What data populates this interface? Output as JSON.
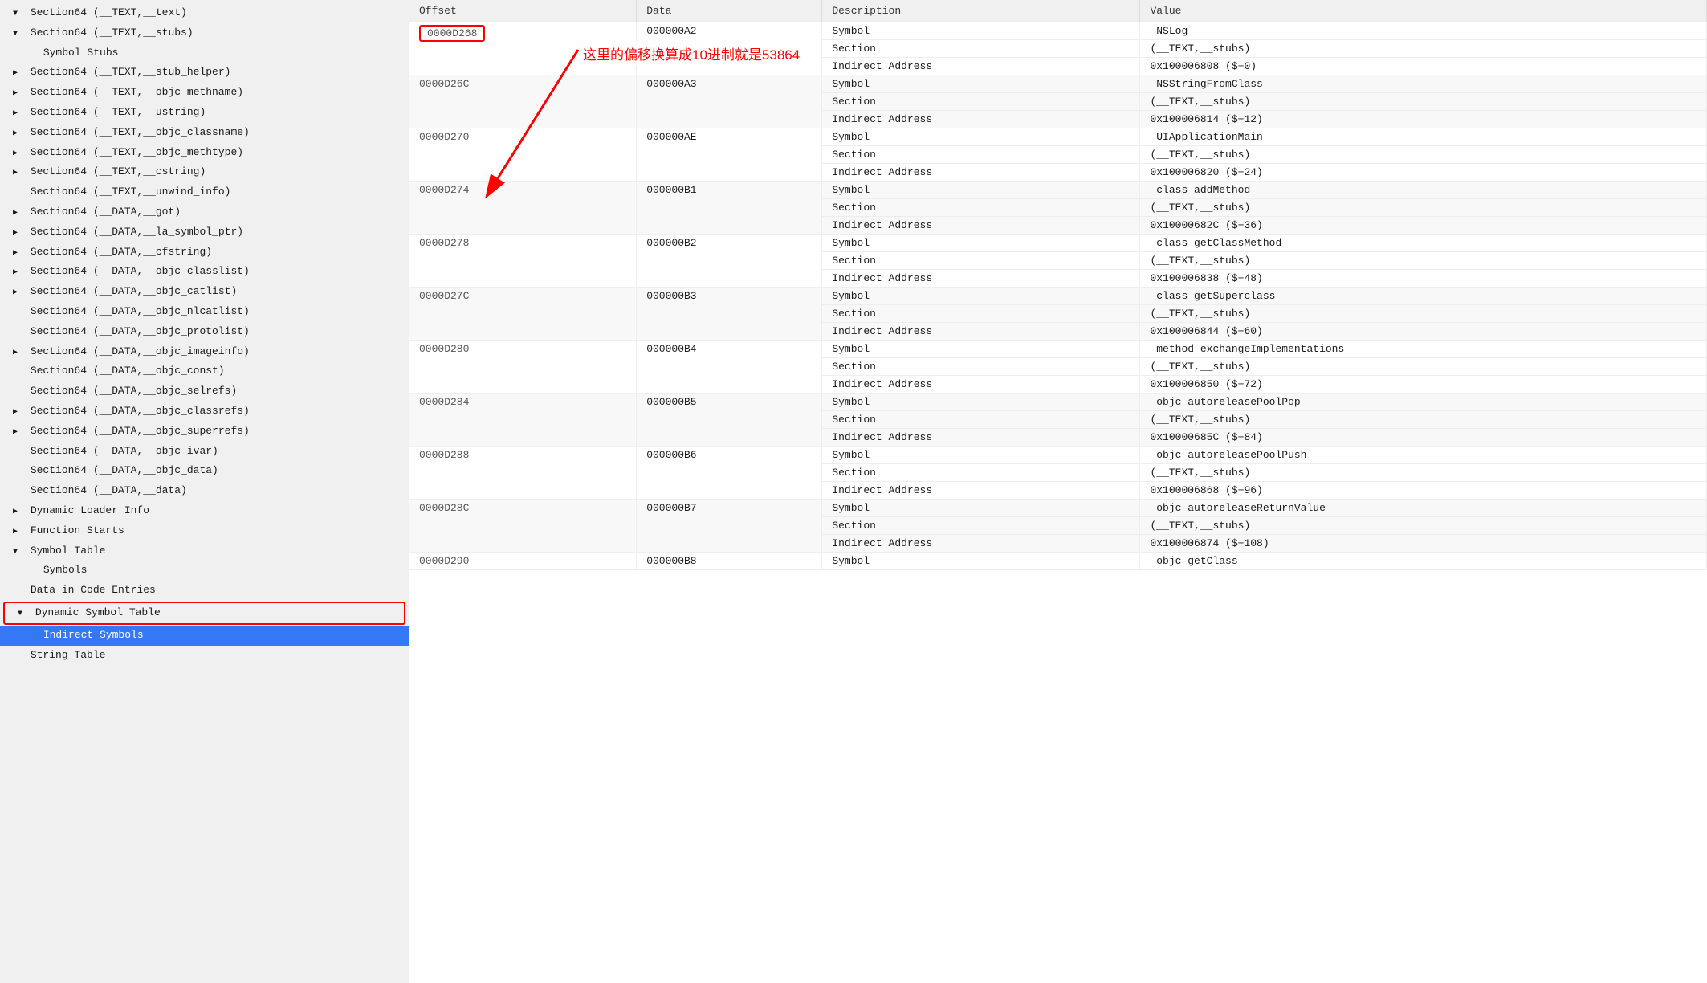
{
  "sidebar": {
    "items": [
      {
        "id": "section64-text-text",
        "label": "Section64 (__TEXT,__text)",
        "indent": 0,
        "arrow": "open",
        "selected": false
      },
      {
        "id": "section64-text-stubs",
        "label": "Section64 (__TEXT,__stubs)",
        "indent": 0,
        "arrow": "open",
        "selected": false
      },
      {
        "id": "symbol-stubs",
        "label": "Symbol Stubs",
        "indent": 1,
        "arrow": "none",
        "selected": false
      },
      {
        "id": "section64-text-stub-helper",
        "label": "Section64 (__TEXT,__stub_helper)",
        "indent": 0,
        "arrow": "closed",
        "selected": false
      },
      {
        "id": "section64-text-objc-methname",
        "label": "Section64 (__TEXT,__objc_methname)",
        "indent": 0,
        "arrow": "closed",
        "selected": false
      },
      {
        "id": "section64-text-ustring",
        "label": "Section64 (__TEXT,__ustring)",
        "indent": 0,
        "arrow": "closed",
        "selected": false
      },
      {
        "id": "section64-text-objc-classname",
        "label": "Section64 (__TEXT,__objc_classname)",
        "indent": 0,
        "arrow": "closed",
        "selected": false
      },
      {
        "id": "section64-text-objc-methtype",
        "label": "Section64 (__TEXT,__objc_methtype)",
        "indent": 0,
        "arrow": "closed",
        "selected": false
      },
      {
        "id": "section64-text-cstring",
        "label": "Section64 (__TEXT,__cstring)",
        "indent": 0,
        "arrow": "closed",
        "selected": false
      },
      {
        "id": "section64-text-unwind-info",
        "label": "Section64 (__TEXT,__unwind_info)",
        "indent": 0,
        "arrow": "none",
        "selected": false
      },
      {
        "id": "section64-data-got",
        "label": "Section64 (__DATA,__got)",
        "indent": 0,
        "arrow": "closed",
        "selected": false
      },
      {
        "id": "section64-data-la-symbol-ptr",
        "label": "Section64 (__DATA,__la_symbol_ptr)",
        "indent": 0,
        "arrow": "closed",
        "selected": false
      },
      {
        "id": "section64-data-cfstring",
        "label": "Section64 (__DATA,__cfstring)",
        "indent": 0,
        "arrow": "closed",
        "selected": false
      },
      {
        "id": "section64-data-objc-classlist",
        "label": "Section64 (__DATA,__objc_classlist)",
        "indent": 0,
        "arrow": "closed",
        "selected": false
      },
      {
        "id": "section64-data-objc-catlist",
        "label": "Section64 (__DATA,__objc_catlist)",
        "indent": 0,
        "arrow": "closed",
        "selected": false
      },
      {
        "id": "section64-data-objc-nlcatlist",
        "label": "Section64 (__DATA,__objc_nlcatlist)",
        "indent": 0,
        "arrow": "none",
        "selected": false
      },
      {
        "id": "section64-data-objc-protolist",
        "label": "Section64 (__DATA,__objc_protolist)",
        "indent": 0,
        "arrow": "none",
        "selected": false
      },
      {
        "id": "section64-data-objc-imageinfo",
        "label": "Section64 (__DATA,__objc_imageinfo)",
        "indent": 0,
        "arrow": "closed",
        "selected": false
      },
      {
        "id": "section64-data-objc-const",
        "label": "Section64 (__DATA,__objc_const)",
        "indent": 0,
        "arrow": "none",
        "selected": false
      },
      {
        "id": "section64-data-objc-selrefs",
        "label": "Section64 (__DATA,__objc_selrefs)",
        "indent": 0,
        "arrow": "none",
        "selected": false
      },
      {
        "id": "section64-data-objc-classrefs",
        "label": "Section64 (__DATA,__objc_classrefs)",
        "indent": 0,
        "arrow": "closed",
        "selected": false
      },
      {
        "id": "section64-data-objc-superrefs",
        "label": "Section64 (__DATA,__objc_superrefs)",
        "indent": 0,
        "arrow": "closed",
        "selected": false
      },
      {
        "id": "section64-data-objc-ivar",
        "label": "Section64 (__DATA,__objc_ivar)",
        "indent": 0,
        "arrow": "none",
        "selected": false
      },
      {
        "id": "section64-data-objc-data",
        "label": "Section64 (__DATA,__objc_data)",
        "indent": 0,
        "arrow": "none",
        "selected": false
      },
      {
        "id": "section64-data-data",
        "label": "Section64 (__DATA,__data)",
        "indent": 0,
        "arrow": "none",
        "selected": false
      },
      {
        "id": "dynamic-loader-info",
        "label": "Dynamic Loader Info",
        "indent": 0,
        "arrow": "closed",
        "selected": false
      },
      {
        "id": "function-starts",
        "label": "Function Starts",
        "indent": 0,
        "arrow": "closed",
        "selected": false
      },
      {
        "id": "symbol-table",
        "label": "Symbol Table",
        "indent": 0,
        "arrow": "open",
        "selected": false
      },
      {
        "id": "symbols",
        "label": "Symbols",
        "indent": 1,
        "arrow": "none",
        "selected": false
      },
      {
        "id": "data-in-code-entries",
        "label": "Data in Code Entries",
        "indent": 0,
        "arrow": "none",
        "selected": false
      },
      {
        "id": "dynamic-symbol-table",
        "label": "Dynamic Symbol Table",
        "indent": 0,
        "arrow": "open",
        "selected": false,
        "highlight": true
      },
      {
        "id": "indirect-symbols",
        "label": "Indirect Symbols",
        "indent": 1,
        "arrow": "none",
        "selected": true
      },
      {
        "id": "string-table",
        "label": "String Table",
        "indent": 0,
        "arrow": "none",
        "selected": false
      }
    ]
  },
  "table": {
    "columns": [
      "Offset",
      "Data",
      "Description",
      "Value"
    ],
    "rows": [
      {
        "offset": "0000D268",
        "offset_highlighted": true,
        "data": "000000A2",
        "entries": [
          {
            "description": "Symbol",
            "value": "_NSLog"
          },
          {
            "description": "Section",
            "value": "(__TEXT,__stubs)"
          },
          {
            "description": "Indirect Address",
            "value": "0x100006808 ($+0)"
          }
        ]
      },
      {
        "offset": "0000D26C",
        "data": "000000A3",
        "entries": [
          {
            "description": "Symbol",
            "value": "_NSStringFromClass"
          },
          {
            "description": "Section",
            "value": "(__TEXT,__stubs)"
          },
          {
            "description": "Indirect Address",
            "value": "0x100006814 ($+12)"
          }
        ]
      },
      {
        "offset": "0000D270",
        "data": "000000AE",
        "entries": [
          {
            "description": "Symbol",
            "value": "_UIApplicationMain"
          },
          {
            "description": "Section",
            "value": "(__TEXT,__stubs)"
          },
          {
            "description": "Indirect Address",
            "value": "0x100006820 ($+24)"
          }
        ]
      },
      {
        "offset": "0000D274",
        "data": "000000B1",
        "entries": [
          {
            "description": "Symbol",
            "value": "_class_addMethod"
          },
          {
            "description": "Section",
            "value": "(__TEXT,__stubs)"
          },
          {
            "description": "Indirect Address",
            "value": "0x10000682C ($+36)"
          }
        ]
      },
      {
        "offset": "0000D278",
        "data": "000000B2",
        "entries": [
          {
            "description": "Symbol",
            "value": "_class_getClassMethod"
          },
          {
            "description": "Section",
            "value": "(__TEXT,__stubs)"
          },
          {
            "description": "Indirect Address",
            "value": "0x100006838 ($+48)"
          }
        ]
      },
      {
        "offset": "0000D27C",
        "data": "000000B3",
        "entries": [
          {
            "description": "Symbol",
            "value": "_class_getSuperclass"
          },
          {
            "description": "Section",
            "value": "(__TEXT,__stubs)"
          },
          {
            "description": "Indirect Address",
            "value": "0x100006844 ($+60)"
          }
        ]
      },
      {
        "offset": "0000D280",
        "data": "000000B4",
        "entries": [
          {
            "description": "Symbol",
            "value": "_method_exchangeImplementations"
          },
          {
            "description": "Section",
            "value": "(__TEXT,__stubs)"
          },
          {
            "description": "Indirect Address",
            "value": "0x100006850 ($+72)"
          }
        ]
      },
      {
        "offset": "0000D284",
        "data": "000000B5",
        "entries": [
          {
            "description": "Symbol",
            "value": "_objc_autoreleasePoolPop"
          },
          {
            "description": "Section",
            "value": "(__TEXT,__stubs)"
          },
          {
            "description": "Indirect Address",
            "value": "0x10000685C ($+84)"
          }
        ]
      },
      {
        "offset": "0000D288",
        "data": "000000B6",
        "entries": [
          {
            "description": "Symbol",
            "value": "_objc_autoreleasePoolPush"
          },
          {
            "description": "Section",
            "value": "(__TEXT,__stubs)"
          },
          {
            "description": "Indirect Address",
            "value": "0x100006868 ($+96)"
          }
        ]
      },
      {
        "offset": "0000D28C",
        "data": "000000B7",
        "entries": [
          {
            "description": "Symbol",
            "value": "_objc_autoreleaseReturnValue"
          },
          {
            "description": "Section",
            "value": "(__TEXT,__stubs)"
          },
          {
            "description": "Indirect Address",
            "value": "0x100006874 ($+108)"
          }
        ]
      },
      {
        "offset": "0000D290",
        "data": "000000B8",
        "entries": [
          {
            "description": "Symbol",
            "value": "_objc_getClass"
          }
        ]
      }
    ]
  },
  "annotation": {
    "text": "这里的偏移换算成10进制就是53864"
  }
}
